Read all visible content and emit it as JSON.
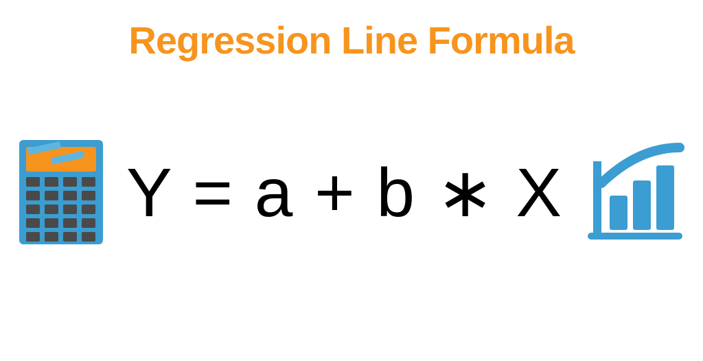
{
  "title": "Regression Line Formula",
  "formula": "Y  =  a + b  ∗ X",
  "icons": {
    "left": "calculator-icon",
    "right": "growth-chart-icon"
  },
  "colors": {
    "accent": "#f7941d",
    "chart": "#3b9dd1",
    "calc_body": "#3b9dd1",
    "calc_screen": "#f7941d",
    "calc_button": "#4a4a4a"
  }
}
